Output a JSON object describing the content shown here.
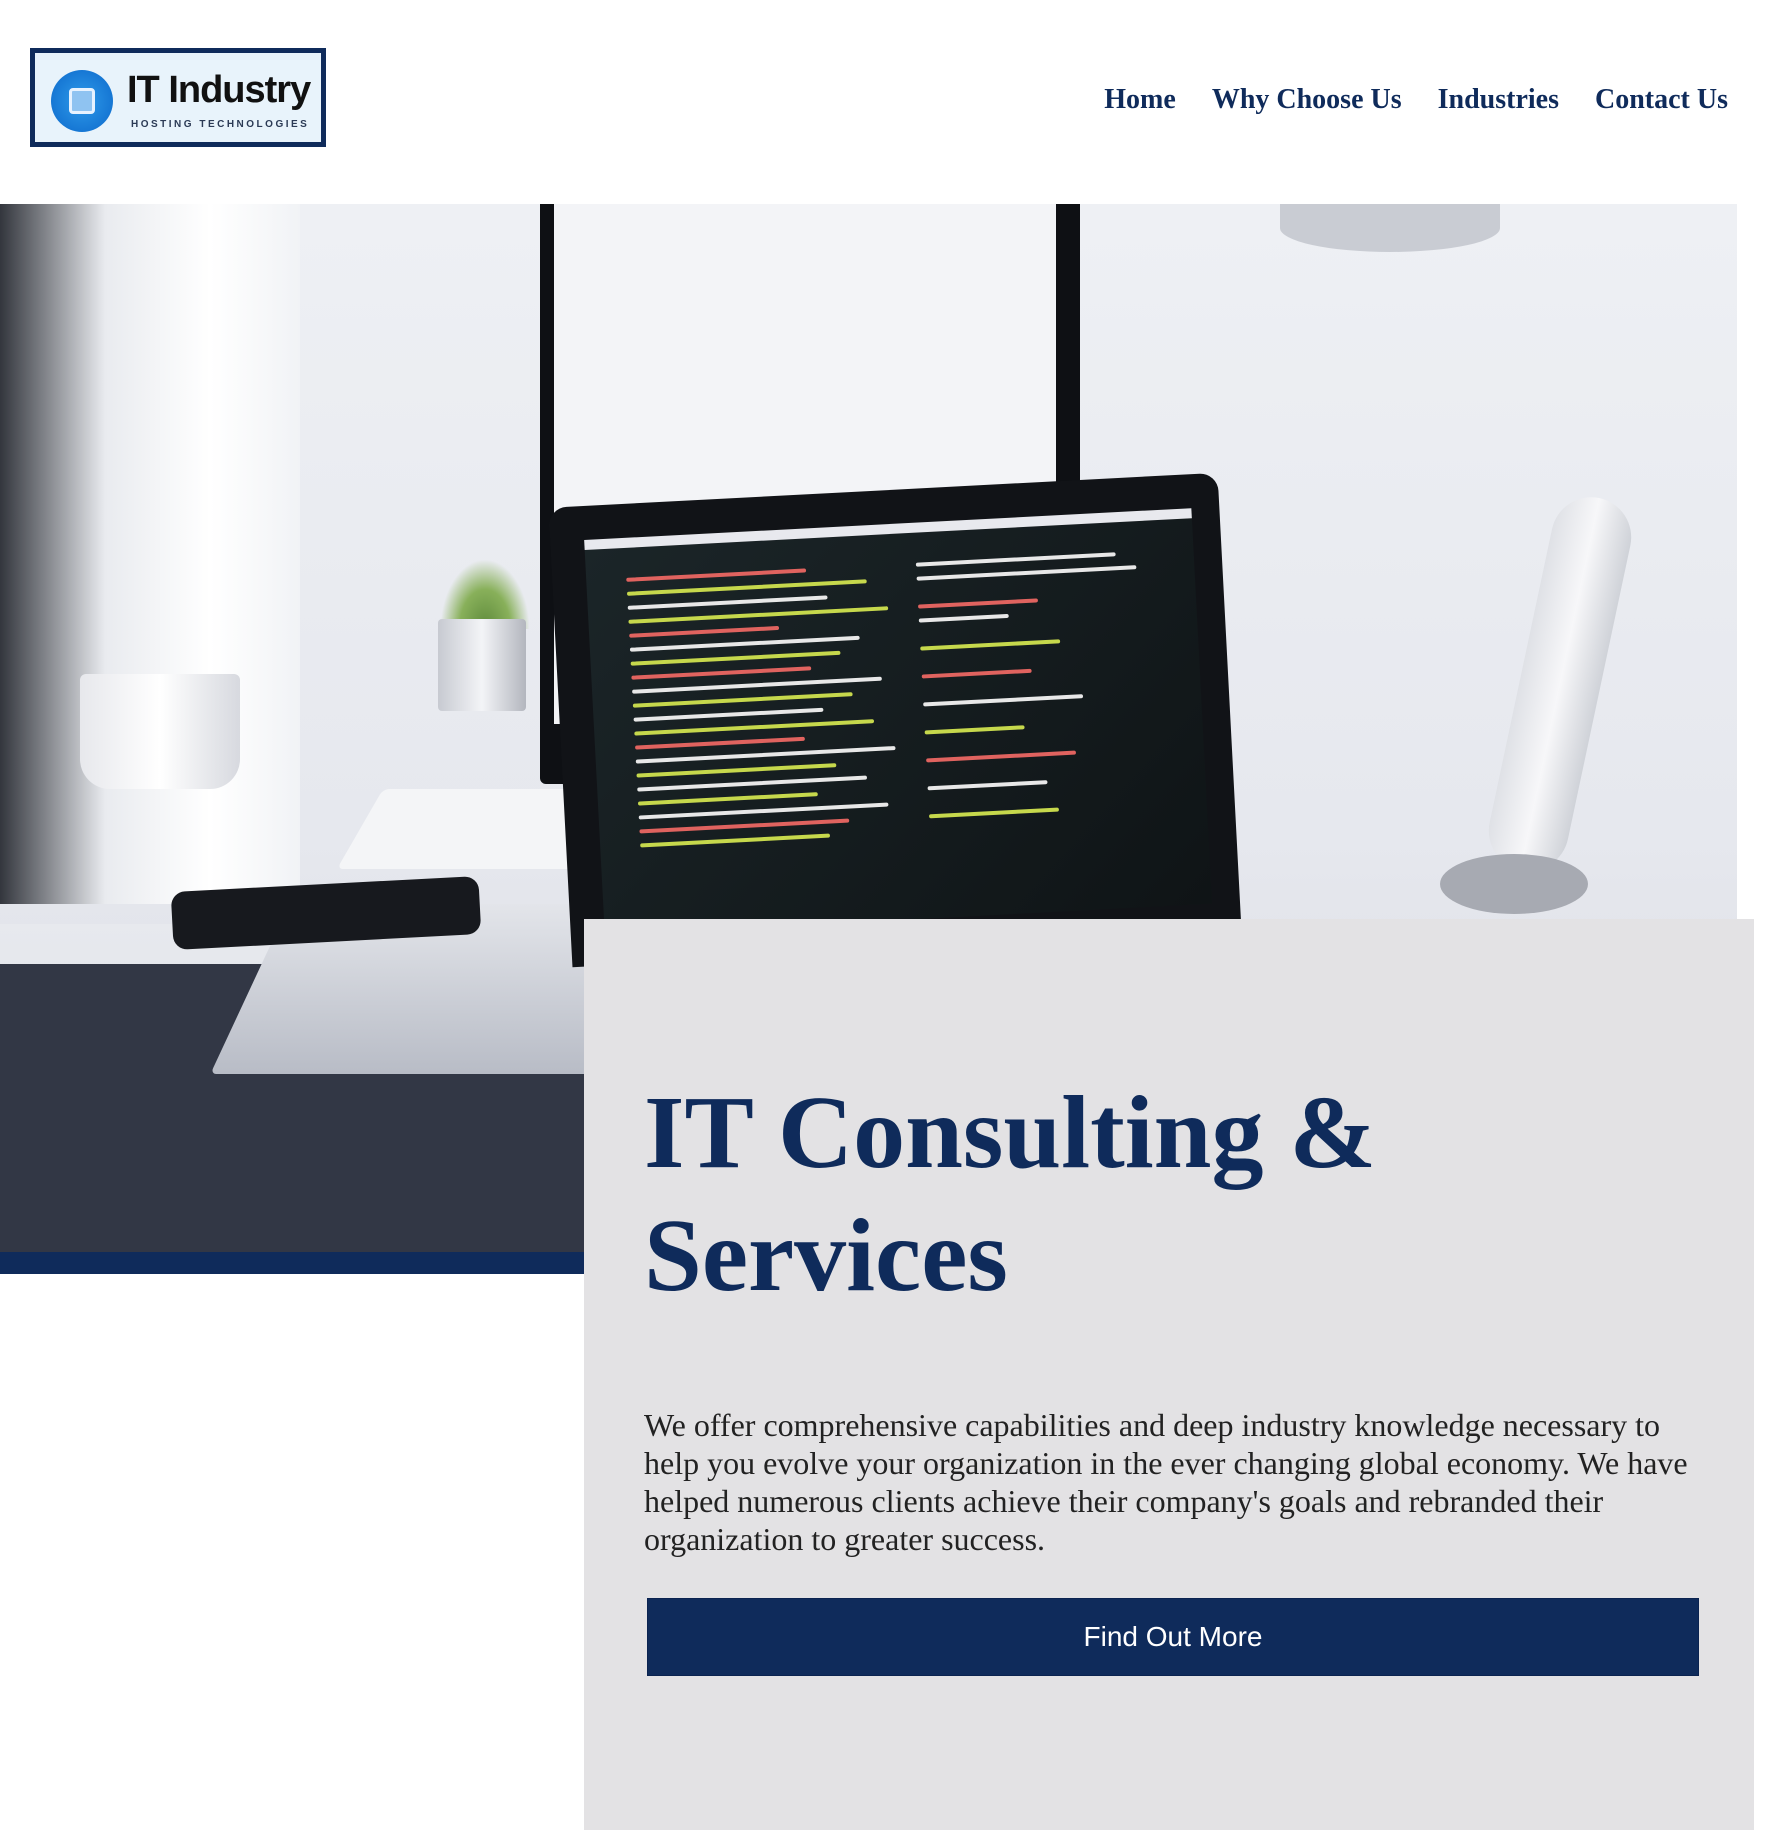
{
  "logo": {
    "title": "IT Industry",
    "subtitle": "HOSTING TECHNOLOGIES",
    "icon": "chip-icon"
  },
  "nav": {
    "items": [
      "Home",
      "Why Choose Us",
      "Industries",
      "Contact Us"
    ]
  },
  "hero": {
    "image": "workspace-photo-laptop-code"
  },
  "card": {
    "title": "IT Consulting & Services",
    "body": "We offer comprehensive capabilities and deep industry knowledge necessary to help you evolve your organization in the ever changing global economy. We have helped numerous clients achieve their company's goals and rebranded their organization to greater success.",
    "button_label": "Find Out More"
  },
  "colors": {
    "brand_navy": "#0f2b5b",
    "card_bg": "#e3e2e4",
    "logo_blue": "#1677d4"
  }
}
